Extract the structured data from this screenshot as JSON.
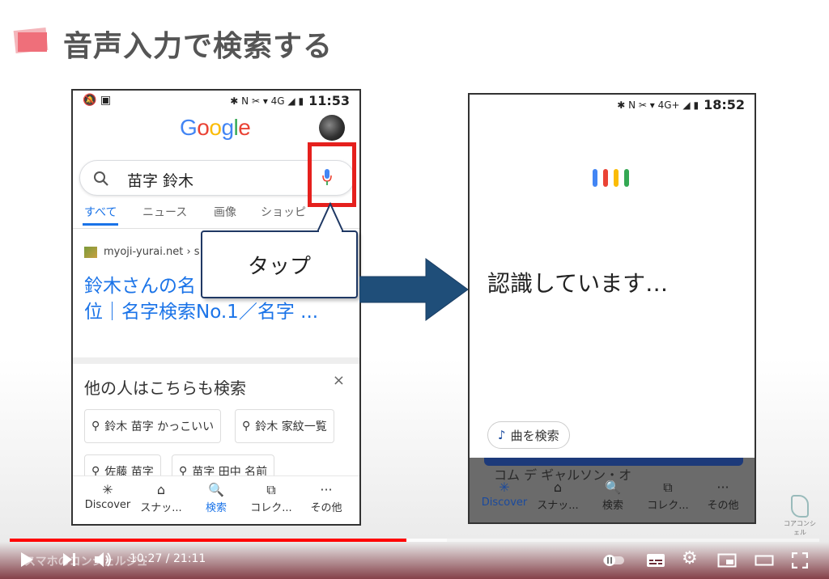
{
  "slide": {
    "title": "音声入力で検索する",
    "title_color": "#555555",
    "accent_color": "#ef6f7a"
  },
  "phone1": {
    "status": {
      "left_icons": "🔕 ▣",
      "right_icons": "✱ N ✂ ▾ 4G ◢ ▮",
      "time": "11:53"
    },
    "logo": "Google",
    "search": {
      "query": "苗字 鈴木",
      "icon": "search-icon"
    },
    "tabs": [
      "すべて",
      "ニュース",
      "画像",
      "ショッピ"
    ],
    "result": {
      "source": "myoji-yurai.net › s",
      "title": "鈴木さんの名 方、全国人数・順位｜名字検索No.1／名字 ..."
    },
    "others": {
      "title": "他の人はこちらも検索",
      "close": "×",
      "chips": [
        "鈴木 苗字 かっこいい",
        "鈴木 家紋一覧",
        "佐藤 苗字",
        "苗字 田中 名前"
      ]
    },
    "nav": [
      {
        "icon": "✳",
        "label": "Discover"
      },
      {
        "icon": "⌂",
        "label": "スナッ..."
      },
      {
        "icon": "🔍",
        "label": "検索"
      },
      {
        "icon": "⧉",
        "label": "コレク..."
      },
      {
        "icon": "···",
        "label": "その他"
      }
    ]
  },
  "callout": {
    "label": "タップ"
  },
  "phone2": {
    "status": {
      "right_icons": "✱ N ✂ ▾ 4G+ ◢ ▮",
      "time": "18:52"
    },
    "dots_colors": [
      "#4285f4",
      "#ea4335",
      "#fbbc05",
      "#34a853"
    ],
    "recognizing": "認識しています…",
    "song_chip": "曲を検索",
    "song_icon": "♪",
    "dim_text": "コム デ ギャルソン・オ",
    "nav": [
      {
        "icon": "✳",
        "label": "Discover"
      },
      {
        "icon": "⌂",
        "label": "スナッ..."
      },
      {
        "icon": "🔍",
        "label": "検索"
      },
      {
        "icon": "⧉",
        "label": "コレク..."
      },
      {
        "icon": "···",
        "label": "その他"
      }
    ]
  },
  "watermark": {
    "text": "コアコンシェル"
  },
  "player": {
    "channel": "スマホのコンシェルジュ",
    "current_time": "10:27",
    "duration": "21:11",
    "time_display": "10:27 / 21:11",
    "played_fraction": 0.49,
    "buffered_fraction": 0.54,
    "progress_color": "#ff0000"
  }
}
